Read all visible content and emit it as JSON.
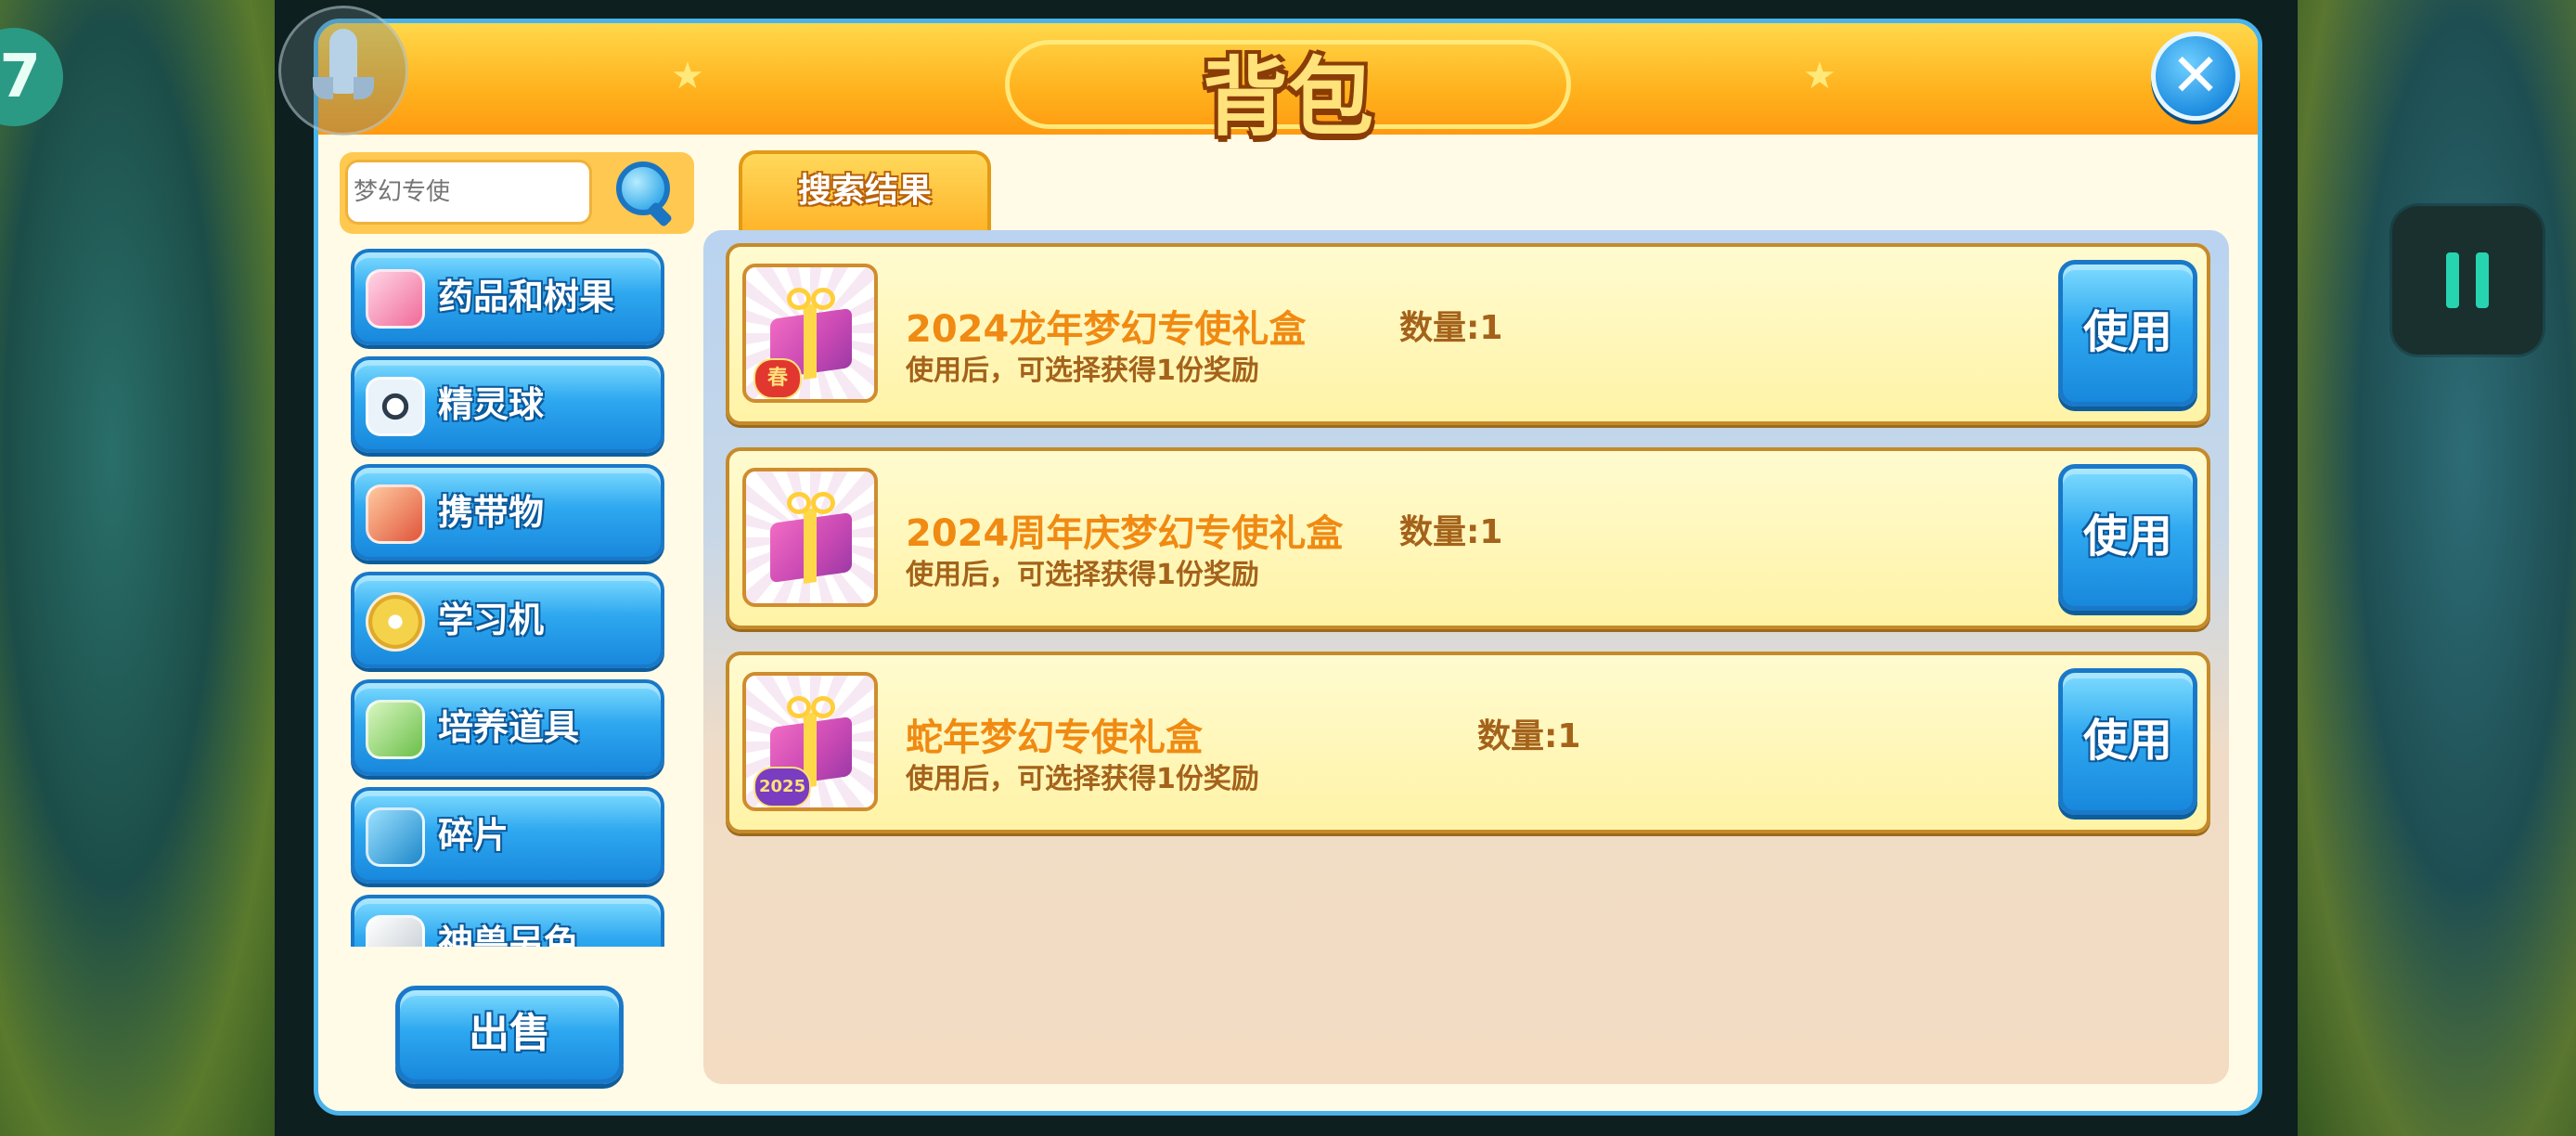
{
  "window": {
    "title": "背包"
  },
  "search": {
    "value": "",
    "placeholder": "梦幻专使"
  },
  "tabs": [
    {
      "label": "搜索结果"
    }
  ],
  "categories": [
    {
      "label": "药品和树果",
      "icon": "potion-icon"
    },
    {
      "label": "精灵球",
      "icon": "pokeball-icon"
    },
    {
      "label": "携带物",
      "icon": "held-item-icon"
    },
    {
      "label": "学习机",
      "icon": "disc-icon"
    },
    {
      "label": "培养道具",
      "icon": "training-item-icon"
    },
    {
      "label": "碎片",
      "icon": "puzzle-piece-icon"
    },
    {
      "label": "神兽另色",
      "icon": "legendary-shiny-icon"
    }
  ],
  "actions": {
    "sell_label": "出售"
  },
  "items": [
    {
      "name": "2024龙年梦幻专使礼盒",
      "count": "数量:1",
      "desc": "使用后，可选择获得1份奖励",
      "use_label": "使用",
      "badge": "春"
    },
    {
      "name": "2024周年庆梦幻专使礼盒",
      "count": "数量:1",
      "desc": "使用后，可选择获得1份奖励",
      "use_label": "使用",
      "badge": ""
    },
    {
      "name": "蛇年梦幻专使礼盒",
      "count": "数量:1",
      "desc": "使用后，可选择获得1份奖励",
      "use_label": "使用",
      "badge": "2025"
    }
  ],
  "overlay": {
    "side_badge": "7"
  },
  "colors": {
    "accent_blue": "#2ea8f0",
    "title_orange": "#ffb21e",
    "item_name": "#f08a12"
  }
}
